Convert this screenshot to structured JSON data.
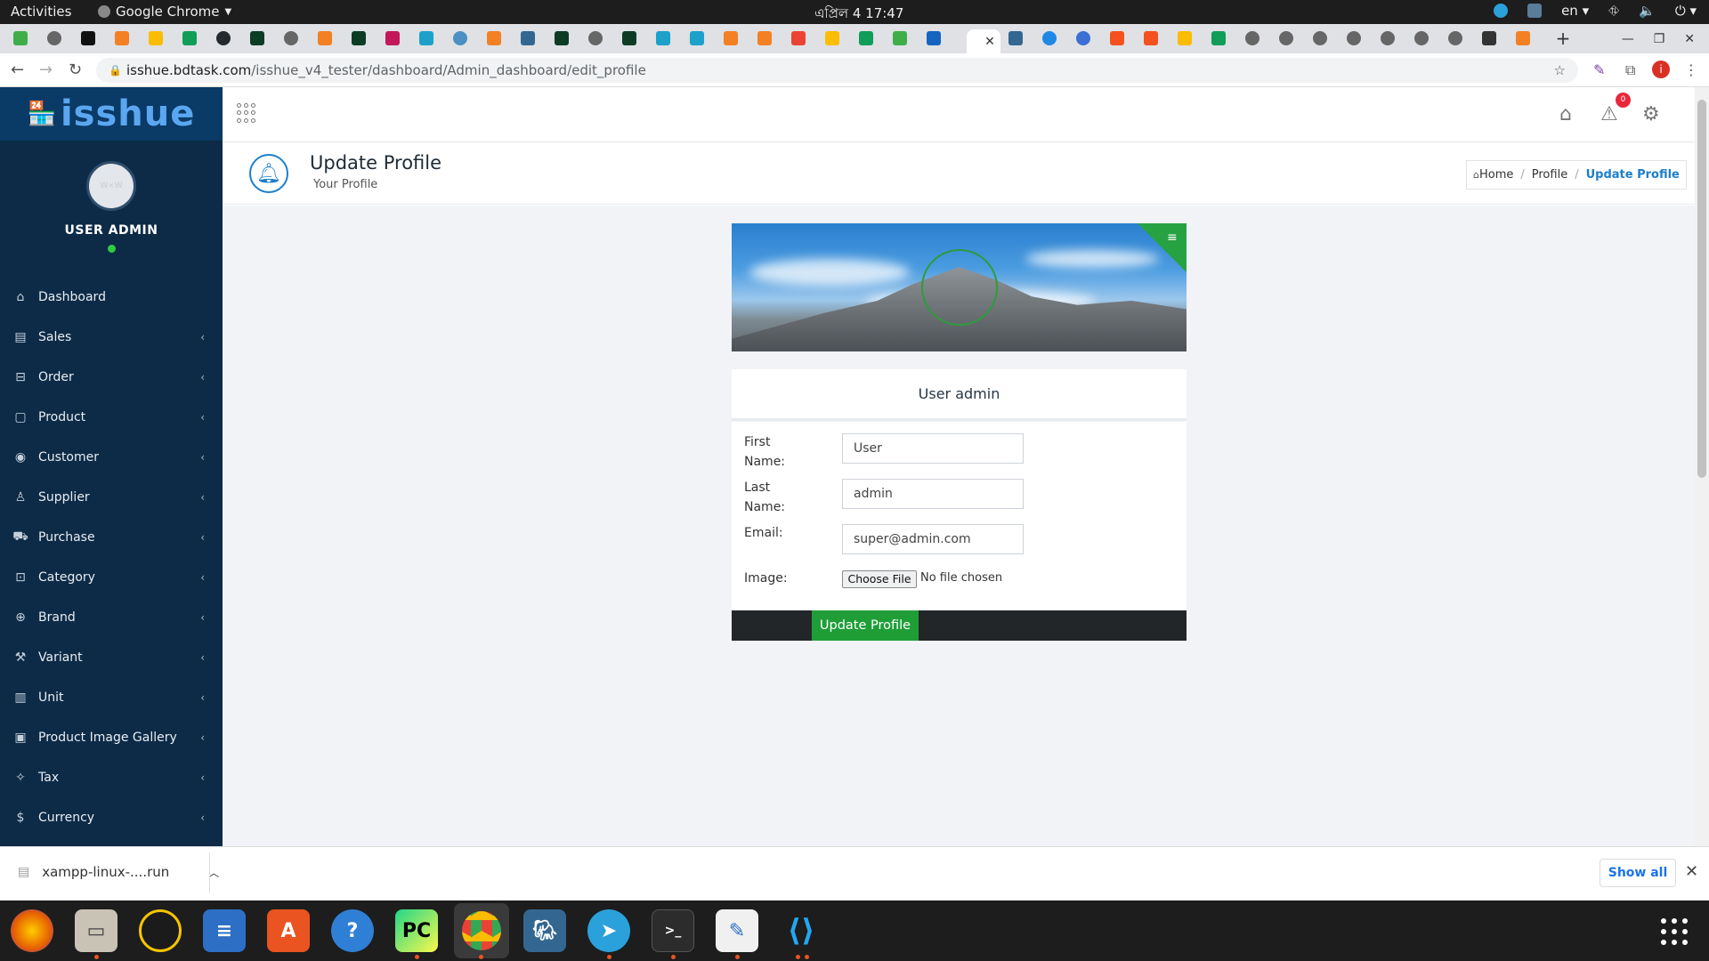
{
  "system": {
    "activities": "Activities",
    "app_name": "Google Chrome",
    "clock": "এপ্রিল 4  17:47",
    "lang": "en"
  },
  "browser": {
    "url_host": "isshue.bdtask.com",
    "url_path": "/isshue_v4_tester/dashboard/Admin_dashboard/edit_profile"
  },
  "sidebar": {
    "logo": "isshue",
    "avatar_text": "W×W",
    "user_name": "USER ADMIN",
    "items": [
      {
        "label": "Dashboard",
        "icon": "home-icon"
      },
      {
        "label": "Sales",
        "icon": "sales-icon"
      },
      {
        "label": "Order",
        "icon": "order-icon"
      },
      {
        "label": "Product",
        "icon": "product-icon"
      },
      {
        "label": "Customer",
        "icon": "customer-icon"
      },
      {
        "label": "Supplier",
        "icon": "supplier-icon"
      },
      {
        "label": "Purchase",
        "icon": "cart-icon"
      },
      {
        "label": "Category",
        "icon": "category-icon"
      },
      {
        "label": "Brand",
        "icon": "brand-icon"
      },
      {
        "label": "Variant",
        "icon": "variant-icon"
      },
      {
        "label": "Unit",
        "icon": "unit-icon"
      },
      {
        "label": "Product Image Gallery",
        "icon": "gallery-icon"
      },
      {
        "label": "Tax",
        "icon": "tax-icon"
      },
      {
        "label": "Currency",
        "icon": "currency-icon"
      }
    ]
  },
  "header": {
    "notification_count": "0"
  },
  "page": {
    "title": "Update Profile",
    "subtitle": "Your Profile",
    "breadcrumb": {
      "home": "Home",
      "profile": "Profile",
      "current": "Update Profile"
    }
  },
  "profile": {
    "display_name": "User admin",
    "first_name_label": "First Name:",
    "first_name_value": "User",
    "last_name_label": "Last Name:",
    "last_name_value": "admin",
    "email_label": "Email:",
    "email_value": "super@admin.com",
    "image_label": "Image:",
    "choose_file": "Choose File",
    "no_file": "No file chosen",
    "submit": "Update Profile"
  },
  "downloads": {
    "file_name": "xampp-linux-....run",
    "show_all": "Show all"
  },
  "colors": {
    "sidebar_bg": "#0d2b47",
    "accent_blue": "#1c7fc9",
    "accent_green": "#1f9e37",
    "badge_red": "#e8273b"
  }
}
